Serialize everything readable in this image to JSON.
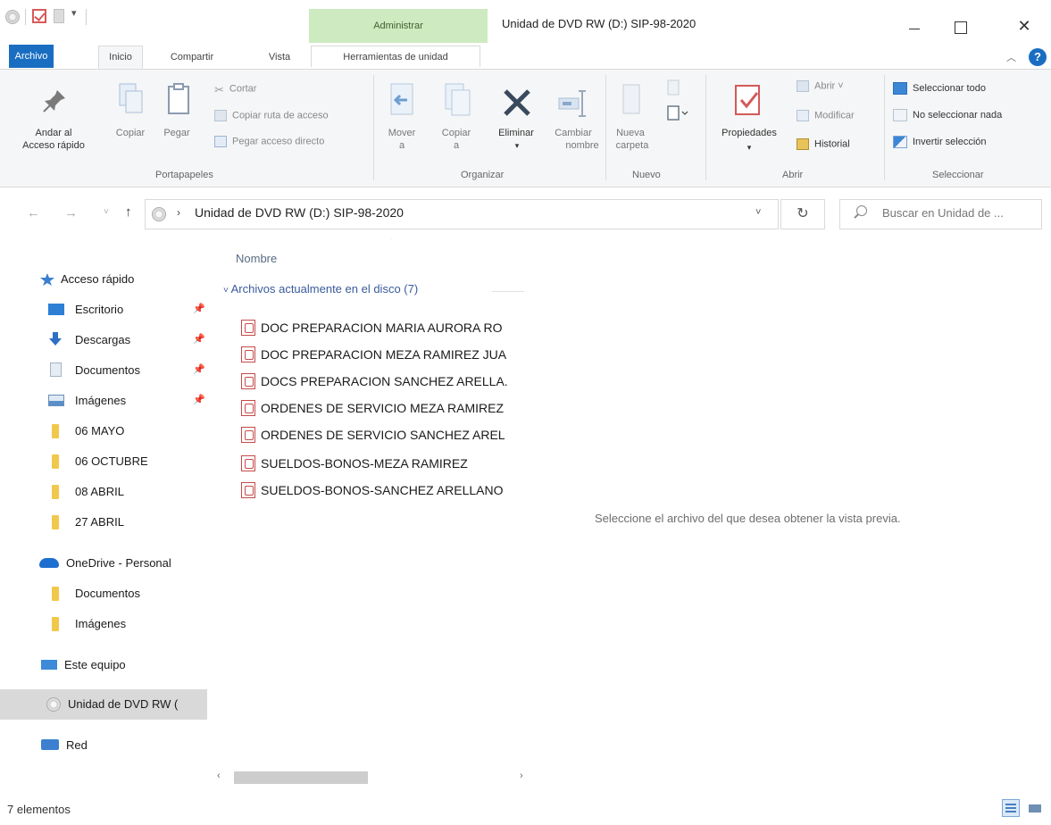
{
  "window": {
    "title": "Unidad de DVD RW (D:) SIP-98-2020",
    "context_tab_header": "Administrar"
  },
  "ribbon_tabs": {
    "archivo": "Archivo",
    "inicio": "Inicio",
    "compartir": "Compartir",
    "vista": "Vista",
    "herramientas": "Herramientas de unidad"
  },
  "ribbon": {
    "portapapeles": {
      "label": "Portapapeles",
      "anclar_line1": "Andar al",
      "anclar_line2": "Acceso rápido",
      "copiar": "Copiar",
      "pegar": "Pegar",
      "cortar": "Cortar",
      "copiar_ruta": "Copiar ruta de acceso",
      "pegar_acceso": "Pegar acceso directo"
    },
    "organizar": {
      "label": "Organizar",
      "mover_line1": "Mover",
      "mover_line2": "a",
      "copiar_line1": "Copiar",
      "copiar_line2": "a",
      "eliminar": "Eliminar",
      "cambiar_line1": "Cambiar",
      "cambiar_line2": "nombre"
    },
    "nuevo": {
      "label": "Nuevo",
      "nueva_line1": "Nueva",
      "nueva_line2": "carpeta"
    },
    "abrir": {
      "label": "Abrir",
      "propiedades": "Propiedades",
      "abrir": "Abrir",
      "modificar": "Modificar",
      "historial": "Historial"
    },
    "seleccionar": {
      "label": "Seleccionar",
      "todo": "Seleccionar todo",
      "nada": "No seleccionar nada",
      "invertir": "Invertir selección"
    }
  },
  "address": {
    "path": "Unidad de DVD RW (D:) SIP-98-2020",
    "search_placeholder": "Buscar en Unidad de ..."
  },
  "nav": {
    "acceso_rapido": "Acceso rápido",
    "escritorio": "Escritorio",
    "descargas": "Descargas",
    "documentos": "Documentos",
    "imagenes": "Imágenes",
    "f1": "06 MAYO",
    "f2": "06 OCTUBRE",
    "f3": "08 ABRIL",
    "f4": "27 ABRIL",
    "onedrive": "OneDrive - Personal",
    "od_documentos": "Documentos",
    "od_imagenes": "Imágenes",
    "este_equipo": "Este equipo",
    "dvd": "Unidad de DVD RW (",
    "red": "Red"
  },
  "files": {
    "column_header": "Nombre",
    "group_header": "Archivos actualmente en el disco (7)",
    "items": [
      "DOC PREPARACION MARIA AURORA RO",
      "DOC PREPARACION MEZA RAMIREZ JUA",
      "DOCS PREPARACION SANCHEZ ARELLA.",
      "ORDENES DE SERVICIO MEZA RAMIREZ",
      "ORDENES DE SERVICIO SANCHEZ AREL",
      "SUELDOS-BONOS-MEZA RAMIREZ",
      "SUELDOS-BONOS-SANCHEZ ARELLANO"
    ]
  },
  "preview": {
    "message": "Seleccione el archivo del que desea obtener la vista previa."
  },
  "status": {
    "count": "7 elementos"
  },
  "colors": {
    "accent": "#1a6ec2",
    "context_tab": "#cdeac0",
    "pdf_red": "#c74a4a",
    "folder_yellow": "#f1c84b"
  }
}
